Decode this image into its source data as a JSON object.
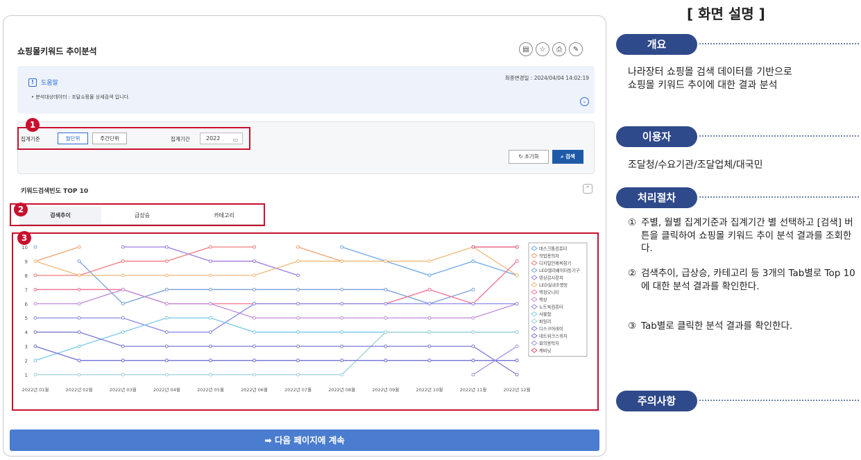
{
  "side_panel": {
    "header": "[ 화면 설명 ]",
    "overview": {
      "label": "개요",
      "lines": [
        "나라장터 쇼핑몰 검색 데이터를 기반으로",
        "쇼핑몰 키워드 추이에 대한 결과 분석"
      ]
    },
    "users": {
      "label": "이용자",
      "text": "조달청/수요기관/조달업체/대국민"
    },
    "procedure": {
      "label": "처리절차",
      "steps": [
        {
          "num": "①",
          "text": "주별, 월별 집계기준과 집계기간 별 선택하고 [검색] 버튼을 클릭하여 쇼핑몰 키워드 추이 분석 결과를 조회한다."
        },
        {
          "num": "②",
          "text": "검색추이, 급상승, 카테고리 등 3개의 Tab별로 Top 10에 대한 분석 결과를 확인한다."
        },
        {
          "num": "③",
          "text": "Tab별로 클릭한 분석 결과를 확인한다."
        }
      ]
    },
    "caution": {
      "label": "주의사항"
    }
  },
  "page": {
    "title": "쇼핑몰키워드 추이분석",
    "toolbar_icons": [
      "manual-icon",
      "star-icon",
      "print-icon",
      "tool-icon"
    ]
  },
  "help": {
    "title": "도움말",
    "updated": "최종변경일 : 2024/04/04 14:02:19",
    "desc": "• 분석대상데이터 : 조달쇼핑몰 상세검색 입니다."
  },
  "search": {
    "criteria_label": "집계기준",
    "unit_month": "월단위",
    "unit_week": "주간단위",
    "period_label": "집계기간",
    "year": "2022",
    "reset_label": "초기화",
    "search_label": "검색"
  },
  "section": {
    "title": "키워드검색빈도 TOP 10"
  },
  "tabs": [
    "검색추이",
    "급상승",
    "카테고리"
  ],
  "badges": [
    "1",
    "2",
    "3"
  ],
  "next_button": "➡ 다음 페이지에 계속",
  "colors": {
    "brand": "#2f4a8a",
    "accent_red": "#c8102e",
    "search_button": "#1f5aa8",
    "next_bar": "#4a7ccf"
  },
  "chart_data": {
    "type": "line",
    "x": [
      "2022년 01월",
      "2022년 02월",
      "2022년 03월",
      "2022년 04월",
      "2022년 05월",
      "2022년 06월",
      "2022년 07월",
      "2022년 08월",
      "2022년 09월",
      "2022년 10월",
      "2022년 11월",
      "2022년 12월"
    ],
    "ylim": [
      1,
      10
    ],
    "yticks": [
      "1",
      "2",
      "3",
      "4",
      "5",
      "6",
      "7",
      "8",
      "9",
      "10"
    ],
    "grid": false,
    "legend_position": "right",
    "series": [
      {
        "name": "데스크톱컴퓨터",
        "color": "#6aa8e8",
        "values": [
          10,
          null,
          null,
          null,
          null,
          null,
          null,
          10,
          9,
          8,
          9,
          8
        ]
      },
      {
        "name": "작업용의자",
        "color": "#f0a070",
        "values": [
          9,
          10,
          null,
          null,
          null,
          null,
          10,
          9,
          null,
          null,
          null,
          null
        ]
      },
      {
        "name": "디지털인쇄복합기",
        "color": "#f07a7a",
        "values": [
          8,
          8,
          9,
          9,
          10,
          10,
          null,
          null,
          null,
          null,
          null,
          null
        ]
      },
      {
        "name": "LED엘리베이터등기구",
        "color": "#7aa0d8",
        "values": [
          null,
          9,
          6,
          7,
          7,
          7,
          7,
          7,
          7,
          6,
          7,
          null
        ]
      },
      {
        "name": "영상감시장치",
        "color": "#9b7ae0",
        "values": [
          null,
          null,
          10,
          10,
          9,
          9,
          8,
          null,
          null,
          null,
          null,
          null
        ]
      },
      {
        "name": "LED실내조명등",
        "color": "#f0b878",
        "values": [
          9,
          8,
          8,
          8,
          8,
          8,
          9,
          9,
          9,
          9,
          10,
          8
        ]
      },
      {
        "name": "액정모니터",
        "color": "#f07090",
        "values": [
          7,
          7,
          7,
          6,
          6,
          6,
          6,
          6,
          6,
          7,
          6,
          9
        ]
      },
      {
        "name": "책상",
        "color": "#c08ad8",
        "values": [
          6,
          6,
          7,
          6,
          6,
          5,
          5,
          5,
          5,
          5,
          5,
          6
        ]
      },
      {
        "name": "노트북컴퓨터",
        "color": "#8a8ae8",
        "values": [
          5,
          5,
          5,
          4,
          4,
          6,
          6,
          6,
          6,
          6,
          6,
          6
        ]
      },
      {
        "name": "사물함",
        "color": "#7ac8e8",
        "values": [
          2,
          3,
          4,
          5,
          5,
          4,
          4,
          4,
          4,
          4,
          4,
          4
        ]
      },
      {
        "name": "파일러",
        "color": "#9ad0d8",
        "values": [
          1,
          1,
          1,
          1,
          1,
          1,
          1,
          1,
          4,
          4,
          4,
          4
        ]
      },
      {
        "name": "디스크어레이",
        "color": "#7a7ad0",
        "values": [
          4,
          4,
          3,
          3,
          3,
          3,
          3,
          3,
          3,
          3,
          3,
          1
        ]
      },
      {
        "name": "네트워크스위치",
        "color": "#6f6fd8",
        "values": [
          3,
          2,
          2,
          2,
          2,
          2,
          2,
          2,
          2,
          2,
          2,
          2
        ]
      },
      {
        "name": "회의용탁자",
        "color": "#a090e0",
        "values": [
          null,
          null,
          null,
          null,
          null,
          null,
          null,
          null,
          null,
          null,
          1,
          3
        ]
      },
      {
        "name": "캐비닛",
        "color": "#e05070",
        "values": [
          null,
          null,
          null,
          null,
          null,
          null,
          null,
          null,
          null,
          null,
          10,
          10
        ]
      }
    ]
  }
}
